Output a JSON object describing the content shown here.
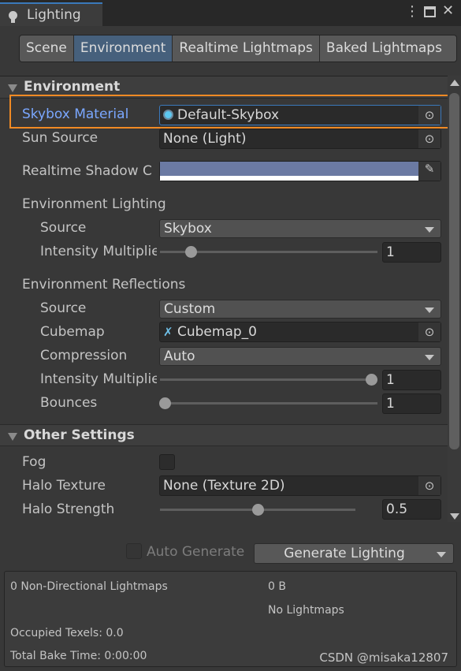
{
  "window": {
    "title": "Lighting",
    "icons": [
      "bulb-icon",
      "more-vert-icon",
      "maximize-icon",
      "close-icon"
    ]
  },
  "tabs": [
    {
      "label": "Scene"
    },
    {
      "label": "Environment",
      "active": true
    },
    {
      "label": "Realtime Lightmaps"
    },
    {
      "label": "Baked Lightmaps"
    }
  ],
  "environment": {
    "header": "Environment",
    "skybox_label": "Skybox Material",
    "skybox_value": "Default-Skybox",
    "sun_label": "Sun Source",
    "sun_value": "None (Light)",
    "shadow_label": "Realtime Shadow C",
    "shadow_color": "#6b7aa3",
    "lighting_header": "Environment Lighting",
    "lighting_source_label": "Source",
    "lighting_source_value": "Skybox",
    "lighting_intensity_label": "Intensity Multiplier",
    "lighting_intensity_value": "1",
    "lighting_intensity_range": [
      0,
      8
    ],
    "reflections_header": "Environment Reflections",
    "refl_source_label": "Source",
    "refl_source_value": "Custom",
    "cubemap_label": "Cubemap",
    "cubemap_value": "Cubemap_0",
    "compression_label": "Compression",
    "compression_value": "Auto",
    "refl_intensity_label": "Intensity Multiplier",
    "refl_intensity_value": "1",
    "refl_intensity_range": [
      0,
      1
    ],
    "bounces_label": "Bounces",
    "bounces_value": "1",
    "bounces_range": [
      1,
      5
    ]
  },
  "other": {
    "header": "Other Settings",
    "fog_label": "Fog",
    "fog_checked": false,
    "halo_texture_label": "Halo Texture",
    "halo_texture_value": "None (Texture 2D)",
    "halo_strength_label": "Halo Strength",
    "halo_strength_value": "0.5",
    "halo_strength_range": [
      0,
      1
    ]
  },
  "footer": {
    "auto_generate_label": "Auto Generate",
    "auto_generate_checked": false,
    "generate_label": "Generate Lighting",
    "lightmaps": "0 Non-Directional Lightmaps",
    "size": "0 B",
    "no_lightmaps": "No Lightmaps",
    "texels": "Occupied Texels: 0.0",
    "bake_time": "Total Bake Time: 0:00:00",
    "watermark": "CSDN @misaka12807"
  },
  "colors": {
    "highlight": "#f08a24",
    "label_selected": "#7aa7ff",
    "active_tab": "#46607c"
  }
}
